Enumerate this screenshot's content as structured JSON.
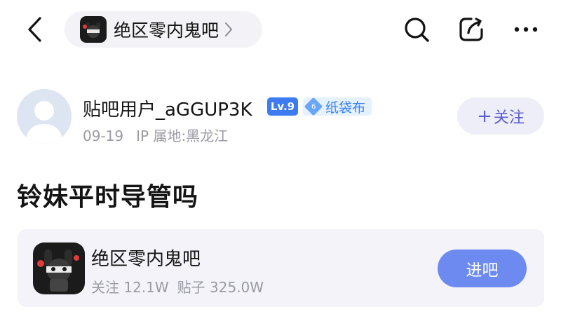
{
  "header": {
    "forum_name": "绝区零内鬼吧"
  },
  "author": {
    "username": "贴吧用户_aGGUP3K",
    "level": "Lv.9",
    "title_level": "6",
    "title": "纸袋布",
    "date": "09-19",
    "ip": "IP 属地:黑龙江",
    "follow_label": "关注"
  },
  "post": {
    "title": "铃妹平时导管吗"
  },
  "forum_card": {
    "name": "绝区零内鬼吧",
    "followers": "关注 12.1W",
    "posts": "贴子 325.0W",
    "enter_label": "进吧"
  },
  "colors": {
    "accent": "#5a5fd0",
    "enter_button": "#6d8af0",
    "level_badge": "#3d7bf0",
    "title_badge_text": "#3a83ee",
    "meta_gray": "#9a9aa3"
  },
  "icons": [
    "back-icon",
    "chevron-right-icon",
    "search-icon",
    "share-icon",
    "more-icon",
    "default-avatar-icon"
  ]
}
